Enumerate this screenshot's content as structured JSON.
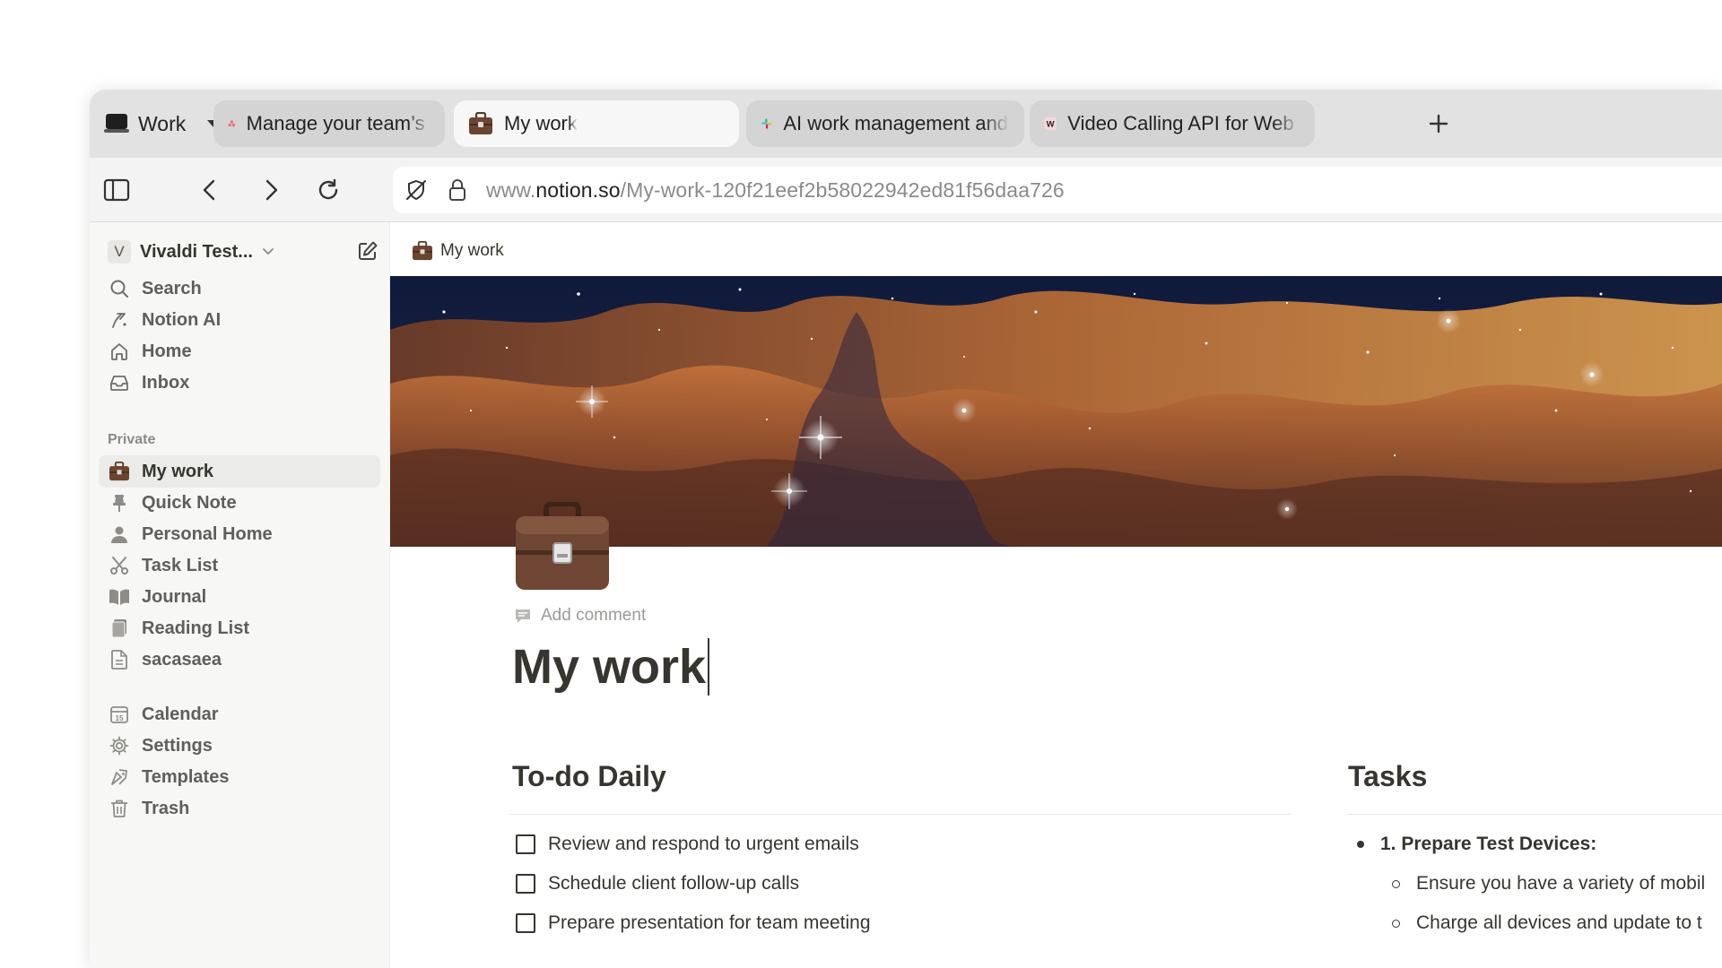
{
  "browser": {
    "workspace_name": "Work",
    "tabs": [
      {
        "label": "Manage your team’s work, projects, & tasks online · Asana",
        "icon": "asana-icon",
        "active": false
      },
      {
        "label": "My work",
        "icon": "briefcase-icon",
        "active": true
      },
      {
        "label": "AI work management and productivity tools | Slack",
        "icon": "slack-icon",
        "active": false
      },
      {
        "label": "Video Calling API for Web and Mobile | Whereby",
        "icon": "whereby-icon",
        "active": false
      }
    ],
    "url": {
      "prefix": "www.",
      "host": "notion.so",
      "path": "/My-work-120f21eef2b58022942ed81f56daa726"
    }
  },
  "sidebar": {
    "workspace": {
      "initial": "V",
      "name": "Vivaldi Test..."
    },
    "top_items": [
      {
        "label": "Search",
        "icon": "search-icon"
      },
      {
        "label": "Notion AI",
        "icon": "notion-ai-icon"
      },
      {
        "label": "Home",
        "icon": "home-icon"
      },
      {
        "label": "Inbox",
        "icon": "inbox-icon"
      }
    ],
    "private_heading": "Private",
    "private_items": [
      {
        "label": "My work",
        "icon": "briefcase-icon",
        "selected": true
      },
      {
        "label": "Quick Note",
        "icon": "pushpin-icon"
      },
      {
        "label": "Personal Home",
        "icon": "person-icon"
      },
      {
        "label": "Task List",
        "icon": "scissors-icon"
      },
      {
        "label": "Journal",
        "icon": "open-book-icon"
      },
      {
        "label": "Reading List",
        "icon": "books-icon"
      },
      {
        "label": "sacasaea",
        "icon": "page-icon"
      }
    ],
    "bottom_items": [
      {
        "label": "Calendar",
        "icon": "calendar-icon"
      },
      {
        "label": "Settings",
        "icon": "gear-icon"
      },
      {
        "label": "Templates",
        "icon": "templates-icon"
      },
      {
        "label": "Trash",
        "icon": "trash-icon"
      }
    ]
  },
  "page": {
    "breadcrumb": "My work",
    "add_comment": "Add comment",
    "title": "My work",
    "todo_heading": "To-do Daily",
    "todos": [
      {
        "text": "Review and respond to urgent emails",
        "checked": false
      },
      {
        "text": "Schedule client follow-up calls",
        "checked": false
      },
      {
        "text": "Prepare presentation for team meeting",
        "checked": false
      }
    ],
    "tasks_heading": "Tasks",
    "tasks": {
      "item": "1. Prepare Test Devices:",
      "subitems": [
        "Ensure you have a variety of mobil",
        "Charge all devices and update to t"
      ]
    }
  }
}
